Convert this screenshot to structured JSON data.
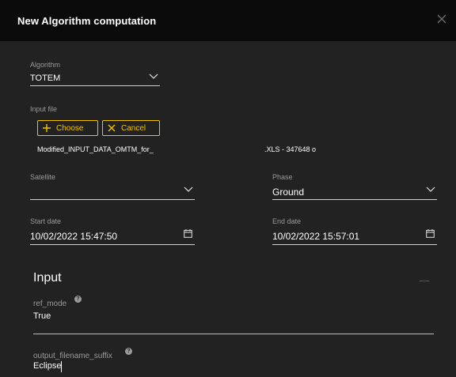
{
  "dialog": {
    "title": "New Algorithm computation"
  },
  "algorithm": {
    "label": "Algorithm",
    "value": "TOTEM"
  },
  "input_file": {
    "label": "Input file",
    "choose_label": "Choose",
    "cancel_label": "Cancel",
    "filename": "Modified_INPUT_DATA_OMTM_for_",
    "file_info": ".XLS - 347648 o"
  },
  "satellite": {
    "label": "Satellite",
    "value": ""
  },
  "phase": {
    "label": "Phase",
    "value": "Ground"
  },
  "start_date": {
    "label": "Start date",
    "value": "10/02/2022 15:47:50"
  },
  "end_date": {
    "label": "End date",
    "value": "10/02/2022 15:57:01"
  },
  "input_section": {
    "title": "Input",
    "ref_mode": {
      "label": "ref_mode",
      "value": "True",
      "help": "?"
    },
    "output_filename_suffix": {
      "label": "output_filename_suffix",
      "value": "Eclipse",
      "help": "?"
    }
  },
  "colors": {
    "accent": "#f2c200",
    "header_bg": "#0b0b0b",
    "dialog_bg": "#222222"
  }
}
